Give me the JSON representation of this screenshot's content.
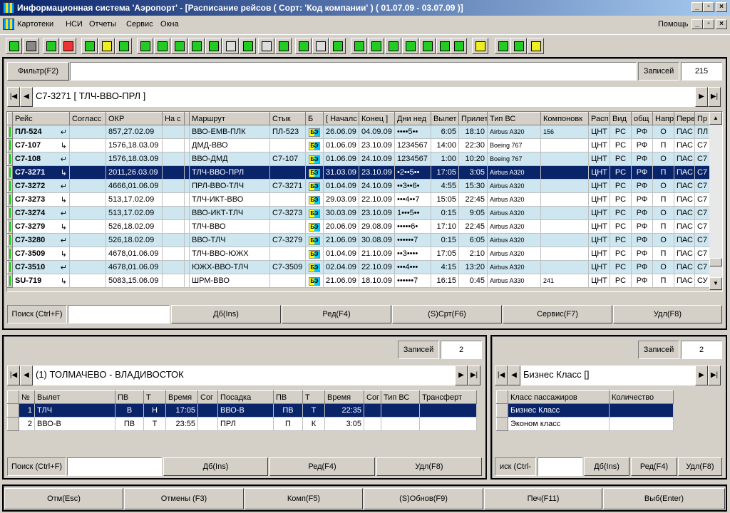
{
  "window": {
    "title": "Информационная система 'Аэропорт' - [Расписание рейсов ( Сорт: 'Код компании' ) ( 01.07.09 - 03.07.09 )]",
    "help": "Помощь"
  },
  "menu": [
    "Картотеки",
    "НСИ",
    "Отчеты",
    "Сервис",
    "Окна"
  ],
  "toolbar": [
    "spo-icon",
    "traffic-light-icon",
    "terminal-icon",
    "chart-icon",
    "table-icon",
    "form-icon",
    "exchange-icon",
    "globe-icon",
    "city-icon",
    "airport-icon",
    "bus-icon",
    "map-icon",
    "board-icon",
    "window-icon",
    "clock-icon",
    "calculator-icon",
    "tools-icon",
    "list-icon",
    "currency-exchange-icon",
    "copy-icon",
    "money-icon",
    "transfer-icon",
    "save-icon",
    "refresh-icon",
    "print-icon",
    "calendar-icon",
    "notes-icon",
    "document-icon",
    "mail-icon",
    "mail-check-icon"
  ],
  "main": {
    "filter_label": "Фильтр(F2)",
    "filter_value": "",
    "records_label": "Записей",
    "records_value": "215",
    "current": "С7-3271 [ ТЛЧ-ВВО-ПРЛ ]",
    "columns": [
      "Рейс",
      "Согласс",
      "ОКР",
      "На с",
      "",
      "Маршрут",
      "Стык",
      "Б",
      "[ Началс",
      "Конец ]",
      "Дни нед",
      "Вылет",
      "Прилет",
      "Тип ВС",
      "Компоновк",
      "Расп",
      "Вид",
      "общ",
      "Напр",
      "Перев",
      "Пр"
    ],
    "rows": [
      [
        "ПЛ-524",
        "↵",
        "857,27.02.09",
        "",
        "",
        "ВВО-ЕМВ-ПЛК",
        "ПЛ-523",
        "БЭ",
        "26.06.09",
        "04.09.09",
        "••••5••",
        "6:05",
        "18:10",
        "Airbus A320",
        "156",
        "ЦНТ",
        "РС",
        "РФ",
        "О",
        "ПАС",
        "ПЛ"
      ],
      [
        "С7-107",
        "↳",
        "1576,18.03.09",
        "",
        "",
        "ДМД-ВВО",
        "",
        "БЭ",
        "01.06.09",
        "23.10.09",
        "1234567",
        "14:00",
        "22:30",
        "Boeing 767",
        "",
        "ЦНТ",
        "РС",
        "РФ",
        "П",
        "ПАС",
        "С7"
      ],
      [
        "С7-108",
        "↵",
        "1576,18.03.09",
        "",
        "",
        "ВВО-ДМД",
        "С7-107",
        "БЭ",
        "01.06.09",
        "24.10.09",
        "1234567",
        "1:00",
        "10:20",
        "Boeing 767",
        "",
        "ЦНТ",
        "РС",
        "РФ",
        "О",
        "ПАС",
        "С7"
      ],
      [
        "С7-3271",
        "↳",
        "2011,26.03.09",
        "",
        "",
        "ТЛЧ-ВВО-ПРЛ",
        "",
        "БЭ",
        "31.03.09",
        "23.10.09",
        "•2••5••",
        "17:05",
        "3:05",
        "Airbus A320",
        "",
        "ЦНТ",
        "РС",
        "РФ",
        "П",
        "ПАС",
        "С7"
      ],
      [
        "С7-3272",
        "↵",
        "4666,01.06.09",
        "",
        "",
        "ПРЛ-ВВО-ТЛЧ",
        "С7-3271",
        "БЭ",
        "01.04.09",
        "24.10.09",
        "••3••6•",
        "4:55",
        "15:30",
        "Airbus A320",
        "",
        "ЦНТ",
        "РС",
        "РФ",
        "О",
        "ПАС",
        "С7"
      ],
      [
        "С7-3273",
        "↳",
        "513,17.02.09",
        "",
        "",
        "ТЛЧ-ИКТ-ВВО",
        "",
        "БЭ",
        "29.03.09",
        "22.10.09",
        "•••4••7",
        "15:05",
        "22:45",
        "Airbus A320",
        "",
        "ЦНТ",
        "РС",
        "РФ",
        "П",
        "ПАС",
        "С7"
      ],
      [
        "С7-3274",
        "↵",
        "513,17.02.09",
        "",
        "",
        "ВВО-ИКТ-ТЛЧ",
        "С7-3273",
        "БЭ",
        "30.03.09",
        "23.10.09",
        "1•••5••",
        "0:15",
        "9:05",
        "Airbus A320",
        "",
        "ЦНТ",
        "РС",
        "РФ",
        "О",
        "ПАС",
        "С7"
      ],
      [
        "С7-3279",
        "↳",
        "526,18.02.09",
        "",
        "",
        "ТЛЧ-ВВО",
        "",
        "БЭ",
        "20.06.09",
        "29.08.09",
        "•••••6•",
        "17:10",
        "22:45",
        "Airbus A320",
        "",
        "ЦНТ",
        "РС",
        "РФ",
        "П",
        "ПАС",
        "С7"
      ],
      [
        "С7-3280",
        "↵",
        "526,18.02.09",
        "",
        "",
        "ВВО-ТЛЧ",
        "С7-3279",
        "БЭ",
        "21.06.09",
        "30.08.09",
        "••••••7",
        "0:15",
        "6:05",
        "Airbus A320",
        "",
        "ЦНТ",
        "РС",
        "РФ",
        "О",
        "ПАС",
        "С7"
      ],
      [
        "С7-3509",
        "↳",
        "4678,01.06.09",
        "",
        "",
        "ТЛЧ-ВВО-ЮЖХ",
        "",
        "БЭ",
        "01.04.09",
        "21.10.09",
        "••3••••",
        "17:05",
        "2:10",
        "Airbus A320",
        "",
        "ЦНТ",
        "РС",
        "РФ",
        "П",
        "ПАС",
        "С7"
      ],
      [
        "С7-3510",
        "↵",
        "4678,01.06.09",
        "",
        "",
        "ЮЖХ-ВВО-ТЛЧ",
        "С7-3509",
        "БЭ",
        "02.04.09",
        "22.10.09",
        "•••4•••",
        "4:15",
        "13:20",
        "Airbus A320",
        "",
        "ЦНТ",
        "РС",
        "РФ",
        "О",
        "ПАС",
        "С7"
      ],
      [
        "SU-719",
        "↳",
        "5083,15.06.09",
        "",
        "",
        "ШРМ-ВВО",
        "",
        "БЭ",
        "21.06.09",
        "18.10.09",
        "••••••7",
        "16:15",
        "0:45",
        "Airbus A330",
        "241",
        "ЦНТ",
        "РС",
        "РФ",
        "П",
        "ПАС",
        "СУ"
      ]
    ],
    "selected_row": 3,
    "search_label": "Поиск (Ctrl+F)",
    "search_value": "",
    "buttons": [
      "Дб(Ins)",
      "Ред(F4)",
      "(S)Срт(F6)",
      "Сервис(F7)",
      "Удл(F8)"
    ]
  },
  "legs": {
    "records_label": "Записей",
    "records_value": "2",
    "current": "(1) ТОЛМАЧЕВО - ВЛАДИВОСТОК",
    "columns": [
      "№",
      "Вылет",
      "ПВ",
      "Т",
      "Время",
      "Сог",
      "Посадка",
      "ПВ",
      "Т",
      "Время",
      "Сог",
      "Тип ВС",
      "Трансферт"
    ],
    "rows": [
      [
        "1",
        "ТЛЧ",
        "В",
        "Н",
        "17:05",
        "",
        "ВВО-В",
        "ПВ",
        "Т",
        "22:35",
        "",
        "",
        ""
      ],
      [
        "2",
        "ВВО-В",
        "ПВ",
        "Т",
        "23:55",
        "",
        "ПРЛ",
        "П",
        "К",
        "3:05",
        "",
        "",
        ""
      ]
    ],
    "search_label": "Поиск (Ctrl+F)",
    "search_value": "",
    "buttons": [
      "Дб(Ins)",
      "Ред(F4)",
      "Удл(F8)"
    ]
  },
  "classes": {
    "records_label": "Записей",
    "records_value": "2",
    "current": "Бизнес Класс []",
    "columns": [
      "Класс пассажиров",
      "Количество"
    ],
    "rows": [
      [
        "Бизнес Класс",
        ""
      ],
      [
        "Эконом класс",
        ""
      ]
    ],
    "search_label": "иск (Ctrl-",
    "search_value": "",
    "buttons": [
      "Дб(Ins)",
      "Ред(F4)",
      "Удл(F8)"
    ]
  },
  "footer": [
    "Отм(Esc)",
    "Отмены (F3)",
    "Комп(F5)",
    "(S)Обнов(F9)",
    "Печ(F11)",
    "Выб(Enter)"
  ],
  "colors": {
    "selection": "#0a246a",
    "row_alt": "#cde6f0",
    "title_start": "#0a246a",
    "title_end": "#a6caf0"
  }
}
